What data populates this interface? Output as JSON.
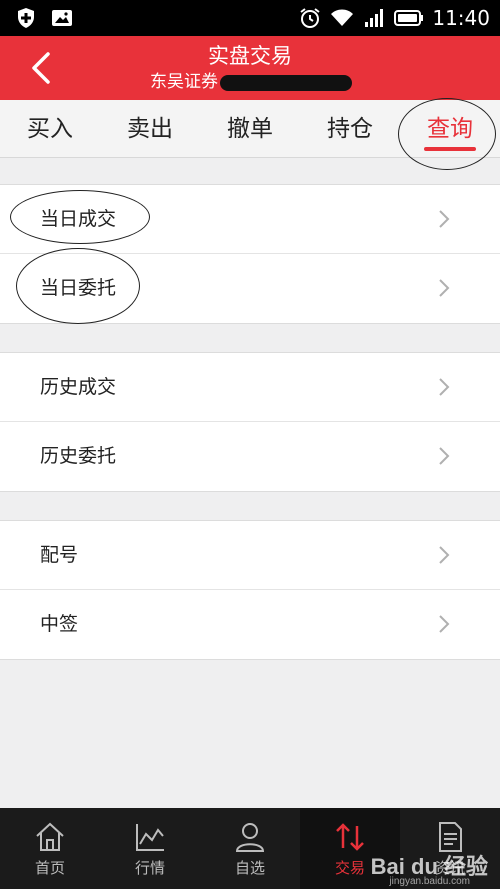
{
  "status_bar": {
    "time": "11:40"
  },
  "header": {
    "title": "实盘交易",
    "broker": "东吴证券",
    "bg_color": "#e8323a"
  },
  "tabs": [
    {
      "label": "买入",
      "active": false
    },
    {
      "label": "卖出",
      "active": false
    },
    {
      "label": "撤单",
      "active": false
    },
    {
      "label": "持仓",
      "active": false
    },
    {
      "label": "查询",
      "active": true
    }
  ],
  "menu_groups": [
    {
      "items": [
        {
          "label": "当日成交"
        },
        {
          "label": "当日委托"
        }
      ]
    },
    {
      "items": [
        {
          "label": "历史成交"
        },
        {
          "label": "历史委托"
        }
      ]
    },
    {
      "items": [
        {
          "label": "配号"
        },
        {
          "label": "中签"
        }
      ]
    }
  ],
  "bottom_nav": [
    {
      "label": "首页",
      "icon": "home-icon",
      "active": false
    },
    {
      "label": "行情",
      "icon": "chart-icon",
      "active": false
    },
    {
      "label": "自选",
      "icon": "user-icon",
      "active": false
    },
    {
      "label": "交易",
      "icon": "trade-arrows-icon",
      "active": true
    },
    {
      "label": "资讯",
      "icon": "document-icon",
      "active": false
    }
  ],
  "watermark": {
    "text": "Bai du 经验",
    "sub": "jingyan.baidu.com"
  },
  "accent_color": "#e8323a"
}
